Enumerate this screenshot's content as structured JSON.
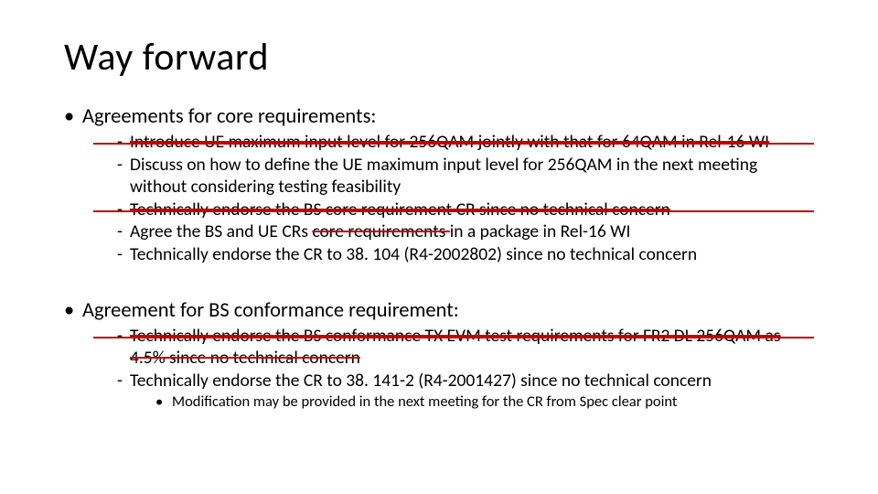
{
  "title": "Way forward",
  "section1": {
    "heading": "Agreements for core requirements:",
    "items": {
      "i0": {
        "text": "Introduce UE maximum input level for 256QAM jointly with that for 64QAM in Rel-16 WI",
        "struck": true
      },
      "i1": {
        "text": "Discuss on how to define the UE maximum input level for 256QAM in the next meeting without considering testing feasibility",
        "struck": false
      },
      "i2": {
        "text": "Technically endorse the BS core requirement CR since no technical concern",
        "struck": true
      },
      "i3": {
        "prefix": "Agree the BS and UE CRs ",
        "struck_mid": "core requirements ",
        "suffix": "in a package in Rel-16 WI"
      },
      "i4": {
        "text": "Technically endorse the CR to 38. 104 (R4-2002802) since no technical concern",
        "struck": false
      }
    }
  },
  "section2": {
    "heading": "Agreement for BS conformance requirement:",
    "items": {
      "j0": {
        "text": "Technically endorse the BS conformance TX EVM test requirements for FR2 DL 256QAM as 4.5% since no technical concern",
        "struck": true
      },
      "j1": {
        "text": "Technically endorse the CR to 38. 141-2 (R4-2001427) since no technical concern",
        "struck": false
      }
    },
    "sub": {
      "k0": "Modification may be provided in the next meeting for the CR from Spec clear point"
    }
  }
}
